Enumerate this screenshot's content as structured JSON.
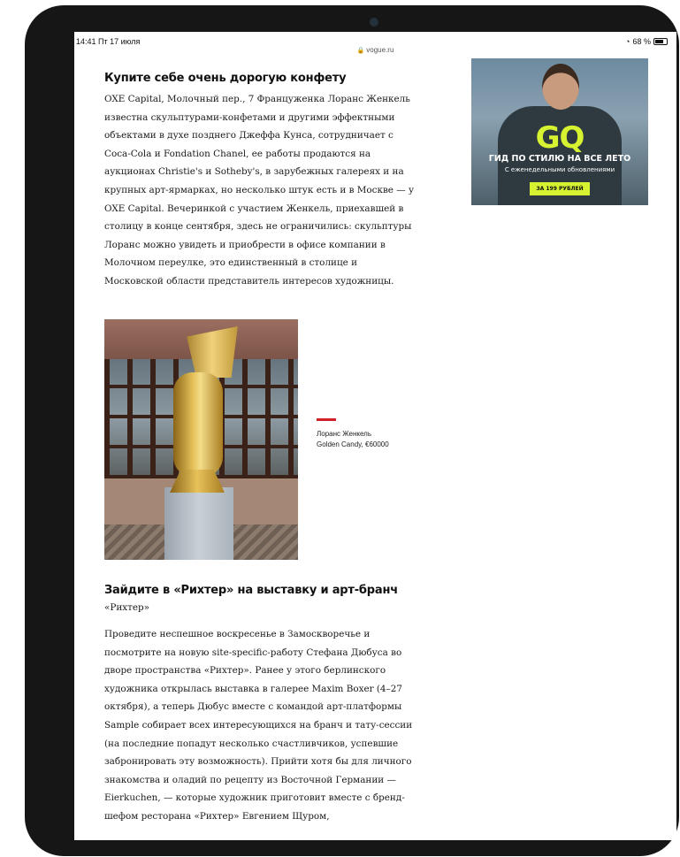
{
  "status_bar": {
    "time_date": "14:41  Пт 17 июля",
    "battery": "68 %",
    "url": "vogue.ru"
  },
  "article": {
    "section1": {
      "heading": "Купите себе очень дорогую конфету",
      "body": "OXE Capital, Молочный пер., 7 Француженка Лоранс Женкель известна скульптурами-конфетами и другими эффектными объектами в духе позднего Джеффа Кунса, сотрудничает с Coca-Cola и Fondation Chanel, ее работы продаются на аукционах Christie's и Sotheby's, в зарубежных галереях и на крупных арт-ярмарках, но несколько штук есть и в Москве — у OXE Capital. Вечеринкой с участием Женкель, приехавшей в столицу в конце сентября, здесь не ограничились: скульптуры Лоранс можно увидеть и приобрести в офисе компании в Молочном переулке, это единственный в столице и Московской области представитель интересов художницы."
    },
    "image_caption": {
      "line1": "Лоранс Женкель",
      "line2": "Golden Candy, €60000"
    },
    "section2": {
      "heading": "Зайдите в «Рихтер» на выставку и арт-бранч",
      "rubric": "«Рихтер»",
      "body": "Проведите неспешное воскресенье в Замоскворечье и посмотрите на новую site-specific-работу Стефана Дюбуса во дворе пространства «Рихтер». Ранее у этого берлинского художника открылась выставка в галерее Maxim Boxer (4–27 октября), а теперь Дюбус вместе с командой арт-платформы Sample собирает всех интересующихся на бранч и тату-сессии (на последние попадут несколько счастливчиков, успевшие забронировать эту возможность). Прийти хотя бы для личного знакомства и оладий по рецепту из Восточной Германии — Eierkuchen, — которые художник приготовит вместе с бренд-шефом ресторана «Рихтер» Евгением Щуром,"
    }
  },
  "ad": {
    "logo": "GQ",
    "headline": "ГИД ПО СТИЛЮ НА ВСЕ ЛЕТО",
    "subline": "С еженедельными обновлениями",
    "button": "ЗА 199 РУБЛЕЙ"
  },
  "colors": {
    "accent_red": "#d0202a",
    "gq_lime": "#d7f230",
    "device_frame": "#161616"
  }
}
